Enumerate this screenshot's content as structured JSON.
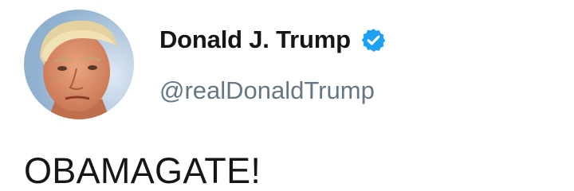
{
  "author": {
    "display_name": "Donald J. Trump",
    "handle": "@realDonaldTrump",
    "verified": true
  },
  "tweet": {
    "text": "OBAMAGATE!"
  },
  "colors": {
    "name": "#14171a",
    "handle": "#657786",
    "verified_badge": "#1da1f2",
    "background": "#ffffff"
  },
  "icons": {
    "verified": "verified-badge-icon"
  }
}
